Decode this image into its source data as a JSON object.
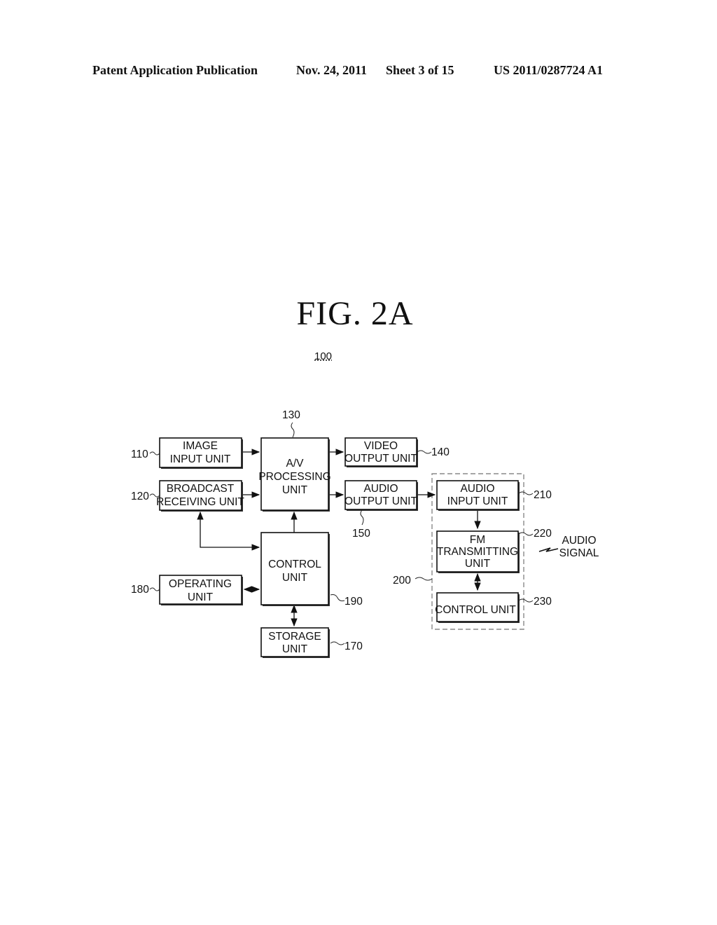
{
  "header": {
    "publication": "Patent Application Publication",
    "date": "Nov. 24, 2011",
    "sheet": "Sheet 3 of 15",
    "number": "US 2011/0287724 A1"
  },
  "figure": {
    "title": "FIG.  2A",
    "reference": "100"
  },
  "blocks": {
    "image_input": {
      "ref": "110",
      "lines": [
        "IMAGE",
        "INPUT UNIT"
      ]
    },
    "broadcast_receiving": {
      "ref": "120",
      "lines": [
        "BROADCAST",
        "RECEIVING UNIT"
      ]
    },
    "av_processing": {
      "ref": "130",
      "lines": [
        "A/V",
        "PROCESSING",
        "UNIT"
      ]
    },
    "video_output": {
      "ref": "140",
      "lines": [
        "VIDEO",
        "OUTPUT UNIT"
      ]
    },
    "audio_output": {
      "ref": "150",
      "lines": [
        "AUDIO",
        "OUTPUT UNIT"
      ]
    },
    "storage": {
      "ref": "170",
      "lines": [
        "STORAGE",
        "UNIT"
      ]
    },
    "operating": {
      "ref": "180",
      "lines": [
        "OPERATING",
        "UNIT"
      ]
    },
    "control": {
      "ref": "190",
      "lines": [
        "CONTROL",
        "UNIT"
      ]
    },
    "fm_device": {
      "ref": "200"
    },
    "audio_input": {
      "ref": "210",
      "lines": [
        "AUDIO",
        "INPUT UNIT"
      ]
    },
    "fm_transmitting": {
      "ref": "220",
      "lines": [
        "FM",
        "TRANSMITTING",
        "UNIT"
      ]
    },
    "control_200": {
      "ref": "230",
      "lines": [
        "CONTROL UNIT"
      ]
    }
  },
  "signal": {
    "lines": [
      "AUDIO",
      "SIGNAL"
    ]
  }
}
